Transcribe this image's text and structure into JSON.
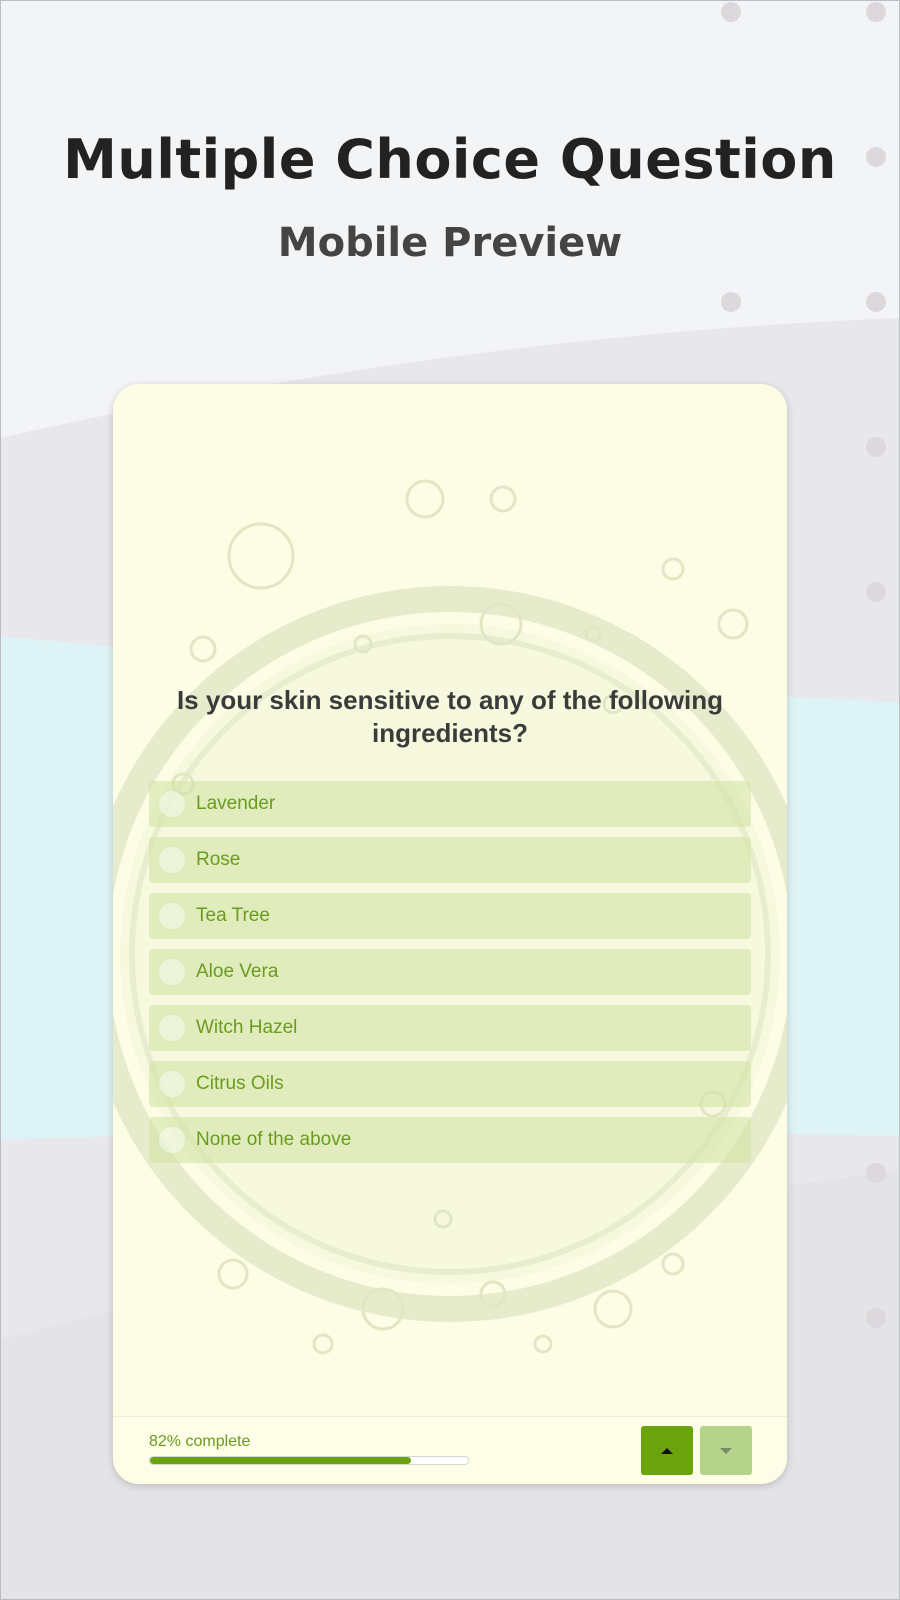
{
  "page": {
    "title": "Multiple Choice Question",
    "subtitle": "Mobile Preview"
  },
  "survey": {
    "question": "Is your skin sensitive to any of the following ingredients?",
    "options": [
      {
        "label": "Lavender",
        "selected": false
      },
      {
        "label": "Rose",
        "selected": false
      },
      {
        "label": "Tea Tree",
        "selected": false
      },
      {
        "label": "Aloe Vera",
        "selected": false
      },
      {
        "label": "Witch Hazel",
        "selected": false
      },
      {
        "label": "Citrus Oils",
        "selected": false
      },
      {
        "label": "None of the above",
        "selected": false
      }
    ],
    "progress_label": "82% complete",
    "progress_percent": 82,
    "nav": {
      "previous_icon": "triangle-up-icon",
      "next_icon": "triangle-down-icon"
    }
  },
  "colors": {
    "accent": "#6aa30b",
    "option_text": "#6a9c1e",
    "card_background": "#fdfde6",
    "band": "#def3f5"
  }
}
